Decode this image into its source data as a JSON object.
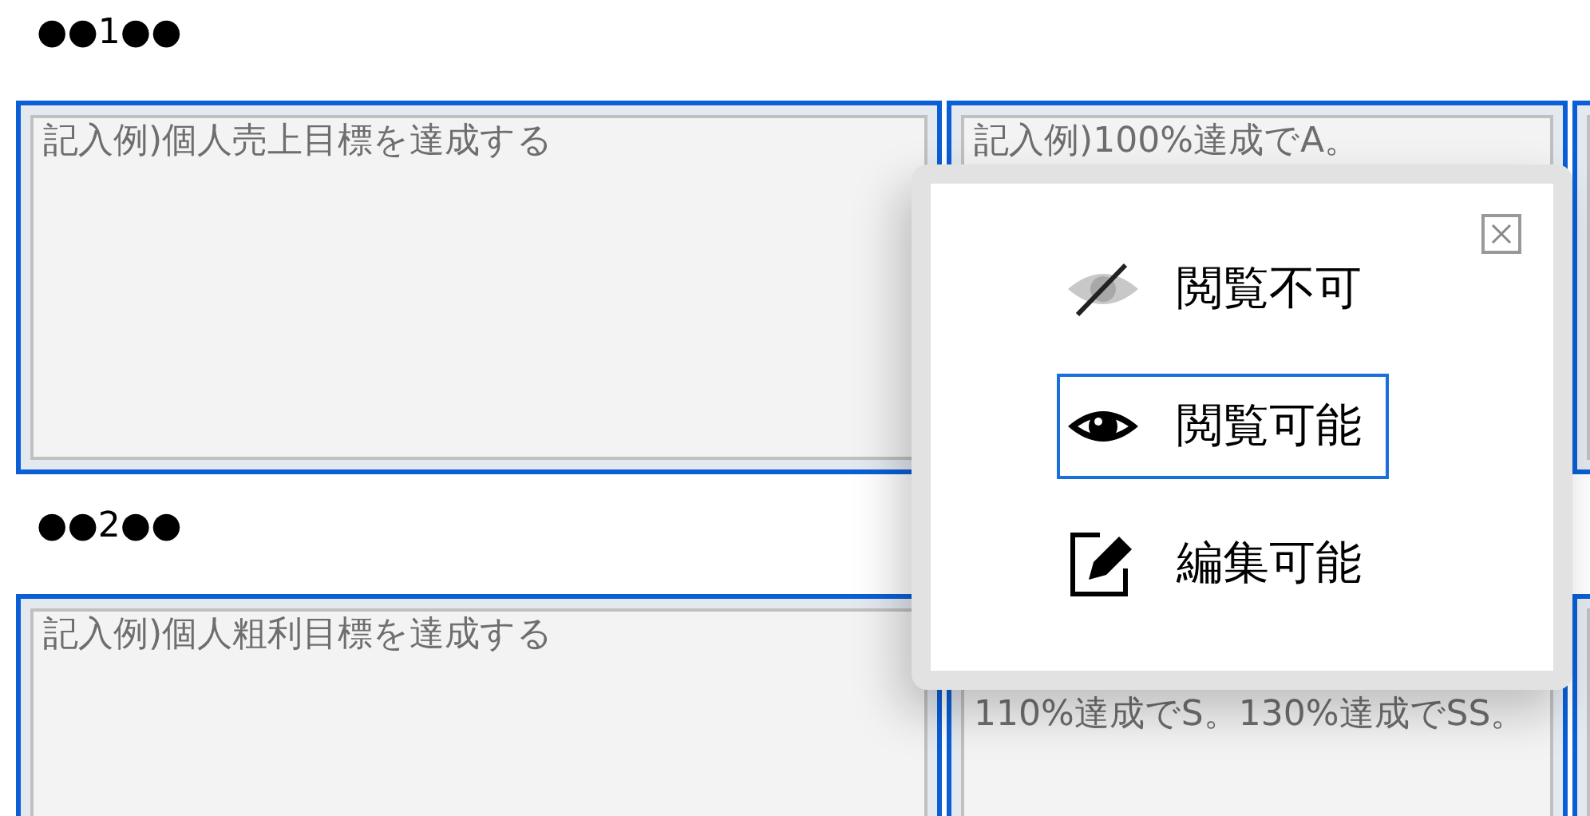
{
  "sections": [
    {
      "heading": "●●1●●",
      "cells": [
        {
          "kind": "full",
          "placeholder": "記入例)個人売上目標を達成する"
        },
        {
          "kind": "full",
          "placeholder": "記入例)100%達成でA。"
        }
      ]
    },
    {
      "heading": "●●2●●",
      "cells": [
        {
          "kind": "full",
          "placeholder": "記入例)個人粗利目標を達成する"
        },
        {
          "kind": "covered",
          "placeholder": "110%達成でS。130%達成でSS。"
        }
      ]
    }
  ],
  "popup": {
    "items": [
      {
        "kind": "hidden",
        "label": "閲覧不可",
        "selected": false
      },
      {
        "kind": "view",
        "label": "閲覧可能",
        "selected": true
      },
      {
        "kind": "edit",
        "label": "編集可能",
        "selected": false
      }
    ]
  }
}
